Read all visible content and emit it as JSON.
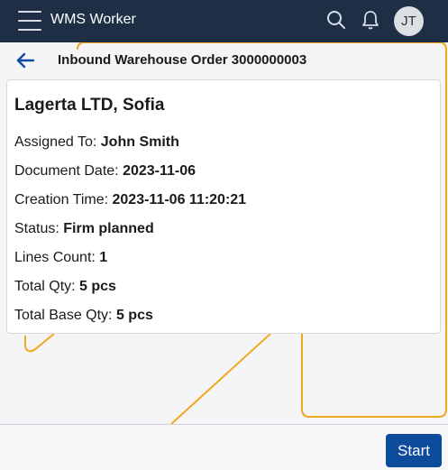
{
  "app": {
    "title": "WMS Worker",
    "avatar_initials": "JT"
  },
  "header": {
    "order_title": "Inbound Warehouse Order 3000000003"
  },
  "card": {
    "title": "Lagerta LTD, Sofia",
    "fields": [
      {
        "label": "Assigned To:",
        "value": "John Smith"
      },
      {
        "label": "Document Date:",
        "value": "2023-11-06"
      },
      {
        "label": "Creation Time:",
        "value": "2023-11-06 11:20:21"
      },
      {
        "label": "Status:",
        "value": "Firm planned"
      },
      {
        "label": "Lines Count:",
        "value": "1"
      },
      {
        "label": "Total Qty:",
        "value": "5 pcs"
      },
      {
        "label": "Total Base Qty:",
        "value": "5 pcs"
      }
    ]
  },
  "footer": {
    "start_label": "Start"
  },
  "icons": {
    "menu": "hamburger-menu-icon",
    "search": "search-icon",
    "notifications": "bell-icon",
    "back": "arrow-left-icon"
  },
  "colors": {
    "topbar": "#1d2e45",
    "accent": "#0d4c9c",
    "decor_line": "#f0a820"
  }
}
